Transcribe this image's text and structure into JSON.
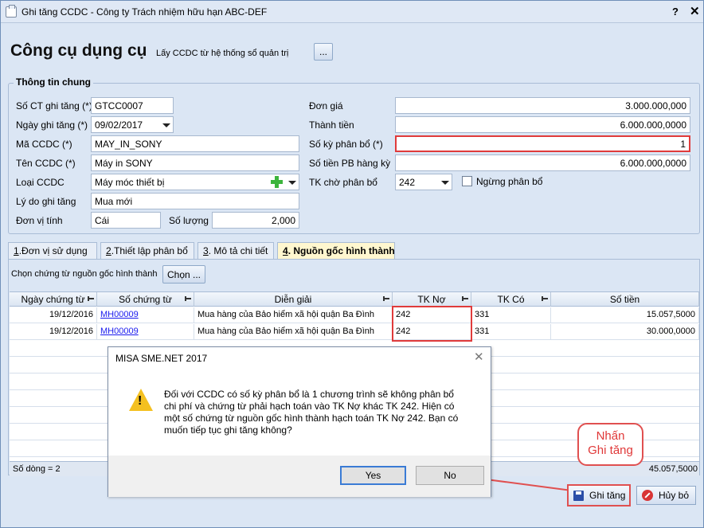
{
  "window": {
    "title": "Ghi tăng CCDC - Công ty Trách nhiệm hữu hạn ABC-DEF",
    "help": "?",
    "close": "✕"
  },
  "header": {
    "title": "Công cụ dụng cụ",
    "import_label": "Lấy CCDC từ hệ thống sổ quản trị",
    "browse_button": "..."
  },
  "general": {
    "group_title": "Thông tin chung",
    "so_ct_label": "Số CT ghi tăng (*)",
    "so_ct_value": "GTCC0007",
    "ngay_label": "Ngày ghi tăng (*)",
    "ngay_value": "09/02/2017",
    "ma_label": "Mã CCDC (*)",
    "ma_value": "MAY_IN_SONY",
    "ten_label": "Tên CCDC (*)",
    "ten_value": "Máy in SONY",
    "loai_label": "Loại CCDC",
    "loai_value": "Máy móc thiết bị",
    "lydo_label": "Lý do ghi tăng",
    "lydo_value": "Mua mới",
    "dvt_label": "Đơn vị tính",
    "dvt_value": "Cái",
    "soluong_label": "Số lượng",
    "soluong_value": "2,000",
    "dongia_label": "Đơn giá",
    "dongia_value": "3.000.000,000",
    "thanhtien_label": "Thành tiền",
    "thanhtien_value": "6.000.000,0000",
    "sokypb_label": "Số kỳ phân bổ (*)",
    "sokypb_value": "1",
    "sotienpb_label": "Số tiền PB hàng kỳ",
    "sotienpb_value": "6.000.000,0000",
    "tkcho_label": "TK chờ phân bổ",
    "tkcho_value": "242",
    "ngung_label": "Ngừng phân bổ"
  },
  "tabs": [
    {
      "num": "1",
      "label": ".Đơn vị sử dụng"
    },
    {
      "num": "2",
      "label": ".Thiết lập phân bổ"
    },
    {
      "num": "3",
      "label": ". Mô tả chi tiết"
    },
    {
      "num": "4",
      "label": ". Nguồn gốc hình thành"
    }
  ],
  "origin": {
    "choose_label": "Chọn chứng từ nguồn gốc hình thành",
    "choose_button": "Chọn ...",
    "columns": [
      "Ngày chứng từ",
      "Số chứng từ",
      "Diễn giải",
      "TK Nợ",
      "TK Có",
      "Số tiền"
    ],
    "rows": [
      {
        "date": "19/12/2016",
        "doc": "MH00009",
        "desc": "Mua hàng của Bảo hiểm xã hội quận Ba Đình",
        "debit": "242",
        "credit": "331",
        "amount": "15.057,5000"
      },
      {
        "date": "19/12/2016",
        "doc": "MH00009",
        "desc": "Mua hàng của Bảo hiểm xã hội quận Ba Đình",
        "debit": "242",
        "credit": "331",
        "amount": "30.000,0000"
      }
    ],
    "row_count": "Số dòng = 2",
    "total": "45.057,5000"
  },
  "dialog": {
    "title": "MISA SME.NET 2017",
    "close": "✕",
    "message": "Đối với CCDC có số kỳ phân bổ là 1 chương trình sẽ không phân bổ chi phí và chứng từ phải hạch toán vào TK Nợ khác TK 242. Hiện có một số chứng từ nguồn gốc hình thành hạch toán TK Nợ 242. Bạn có muốn tiếp tục ghi tăng không?",
    "yes": "Yes",
    "no": "No"
  },
  "callout": {
    "line1": "Nhấn",
    "line2": "Ghi tăng"
  },
  "actions": {
    "save": "Ghi tăng",
    "cancel": "Hủy bỏ"
  },
  "colors": {
    "highlight": "#e03b3b",
    "accent": "#dbe6f4",
    "active_tab": "#fff7cf"
  }
}
